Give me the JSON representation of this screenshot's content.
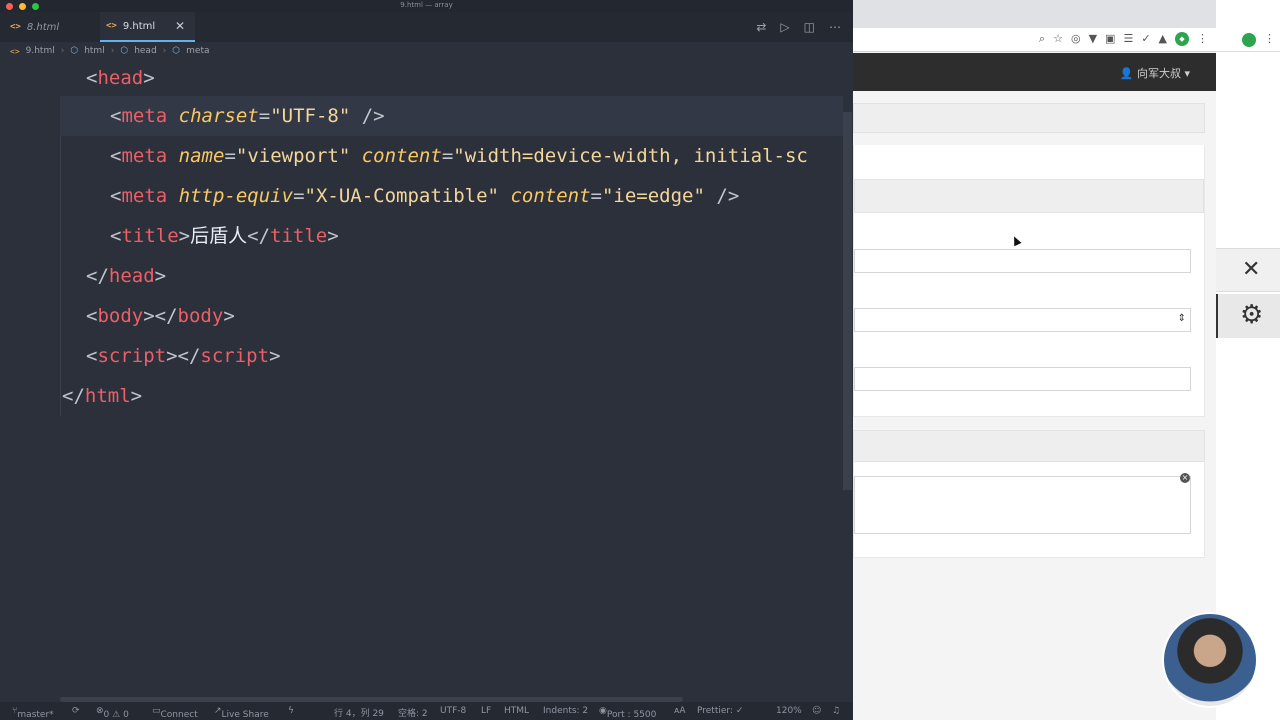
{
  "window": {
    "title": "9.html — array"
  },
  "tabs": [
    {
      "label": "8.html",
      "active": false
    },
    {
      "label": "9.html",
      "active": true
    }
  ],
  "breadcrumb": [
    "9.html",
    "html",
    "head",
    "meta"
  ],
  "code": {
    "line_head_open": {
      "tag": "head"
    },
    "line_meta_charset": {
      "attr": "charset",
      "value": "\"UTF-8\""
    },
    "line_meta_viewport": {
      "attr1": "name",
      "value1": "\"viewport\"",
      "attr2": "content",
      "value2": "\"width=device-width, initial-sc"
    },
    "line_meta_compat": {
      "attr1": "http-equiv",
      "value1": "\"X-UA-Compatible\"",
      "attr2": "content",
      "value2": "\"ie=edge\""
    },
    "line_title": {
      "text": "后盾人"
    },
    "tags": {
      "meta": "meta",
      "title": "title",
      "head": "head",
      "body": "body",
      "script": "script",
      "html": "html"
    }
  },
  "status": {
    "branch": "master*",
    "problems": "0 ⚠ 0",
    "connect": "Connect",
    "live_share": "Live Share",
    "position": "行 4，列 29",
    "spaces": "空格: 2",
    "encoding": "UTF-8",
    "eol": "LF",
    "language": "HTML",
    "indents": "Indents: 2",
    "port": "Port : 5500",
    "prettier": "Prettier: ✓",
    "zoom": "120%"
  },
  "browser": {
    "user_menu": "向军大叔"
  },
  "icons": {
    "tab_file": "code-brackets-icon",
    "close": "close-icon",
    "gear": "gear-icon"
  }
}
